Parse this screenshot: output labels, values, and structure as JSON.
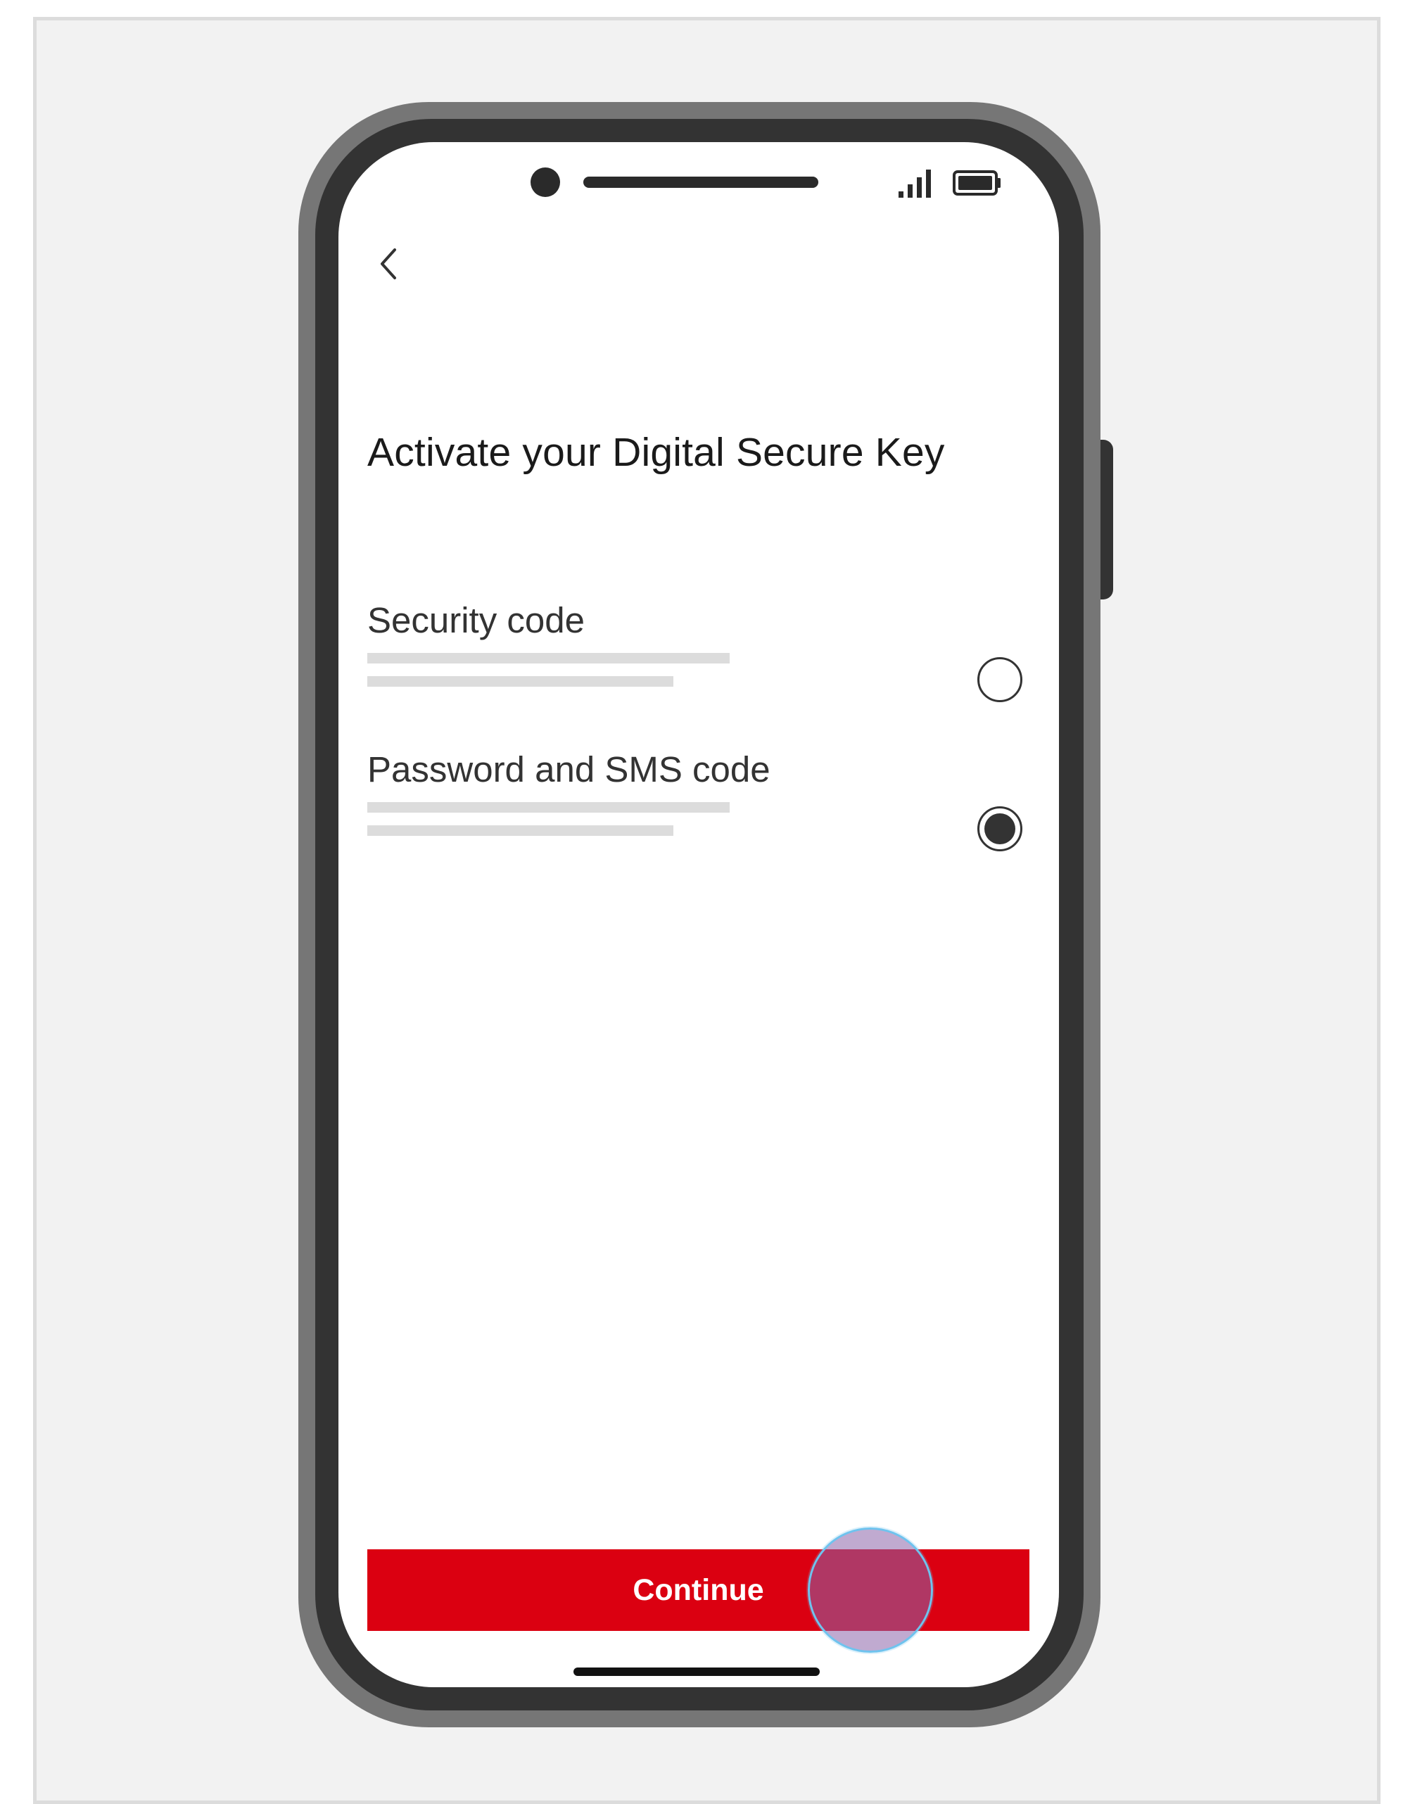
{
  "screen": {
    "title": "Activate your Digital Secure Key",
    "back_icon": "chevron-left-icon",
    "status_icons": [
      "signal-icon",
      "battery-icon"
    ]
  },
  "options": [
    {
      "label": "Security code",
      "selected": false
    },
    {
      "label": "Password and SMS code",
      "selected": true
    }
  ],
  "actions": {
    "continue_label": "Continue"
  },
  "colors": {
    "accent": "#db0011",
    "frame_background": "#f2f2f2",
    "text_primary": "#1a1a1a",
    "placeholder": "#dcdcdc"
  }
}
